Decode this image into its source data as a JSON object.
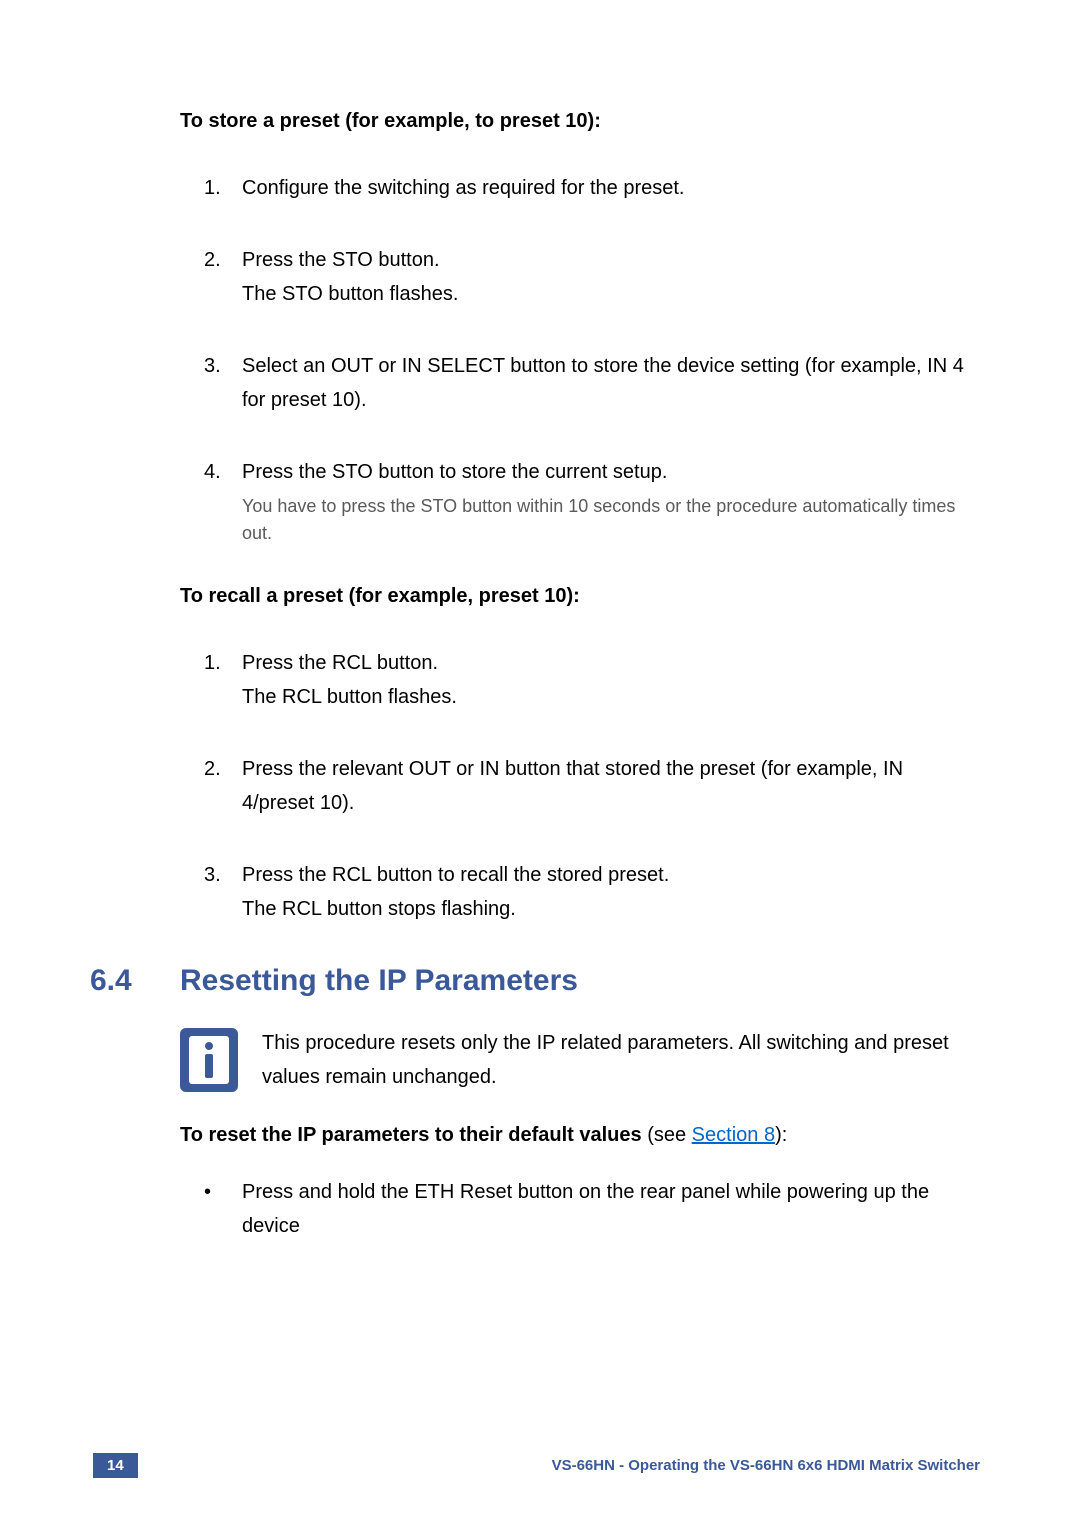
{
  "headings": {
    "store": "To store a preset (for example, to preset 10):",
    "recall": "To recall a preset (for example, preset 10):",
    "reset_bold": "To reset the IP parameters to their default values",
    "reset_plain": " (see ",
    "reset_link": "Section 8",
    "reset_tail": "):"
  },
  "store_steps": [
    {
      "num": "1.",
      "text": "Configure the switching as required for the preset."
    },
    {
      "num": "2.",
      "text": "Press the STO button.",
      "sub": "The STO button flashes."
    },
    {
      "num": "3.",
      "text": "Select an OUT or IN SELECT button to store the device setting (for example, IN 4 for preset 10)."
    },
    {
      "num": "4.",
      "text": "Press the STO button to store the current setup.",
      "note": "You have to press the STO button within 10 seconds or the procedure automatically times out."
    }
  ],
  "recall_steps": [
    {
      "num": "1.",
      "text": "Press the RCL button.",
      "sub": "The RCL button flashes."
    },
    {
      "num": "2.",
      "text": "Press the relevant OUT or IN button that stored the preset (for example, IN 4/preset 10)."
    },
    {
      "num": "3.",
      "text": "Press the RCL button to recall the stored preset.",
      "sub": "The RCL button stops flashing."
    }
  ],
  "section": {
    "num": "6.4",
    "title": "Resetting the IP Parameters"
  },
  "info_text": "This procedure resets only the IP related parameters. All switching and preset values remain unchanged.",
  "bullet_text": "Press and hold the ETH Reset button on the rear panel while powering up the device",
  "footer": {
    "page": "14",
    "text": "VS-66HN - Operating the VS-66HN 6x6 HDMI Matrix Switcher"
  }
}
